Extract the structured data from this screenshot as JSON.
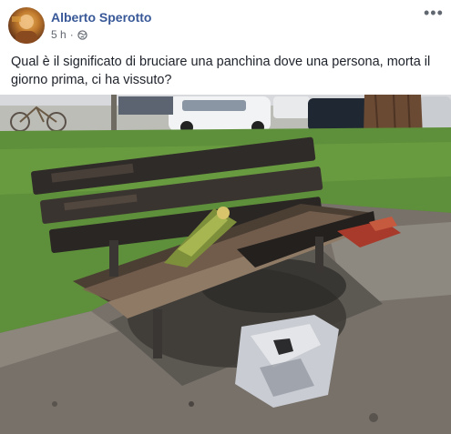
{
  "post": {
    "author": "Alberto Sperotto",
    "time": "5 h",
    "separator": "·",
    "privacy_icon": "globe-icon",
    "more_icon": "more-options-icon",
    "more_label": "•••",
    "text": "Qual è il significato di bruciare una panchina dove una persona, morta il giorno prima, ci ha vissuto?"
  },
  "colors": {
    "author_link": "#385898",
    "meta_text": "#616770",
    "body_text": "#1d2129"
  }
}
